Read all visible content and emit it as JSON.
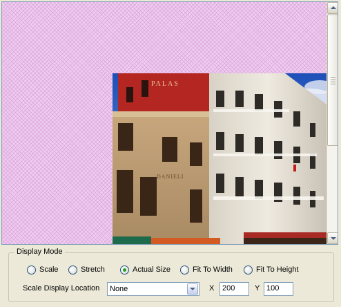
{
  "display_mode": {
    "group_label": "Display Mode",
    "options": [
      {
        "label": "Scale",
        "checked": false
      },
      {
        "label": "Stretch",
        "checked": false
      },
      {
        "label": "Actual Size",
        "checked": true
      },
      {
        "label": "Fit To Width",
        "checked": false
      },
      {
        "label": "Fit To Height",
        "checked": false
      }
    ]
  },
  "scale_location": {
    "label": "Scale Display Location",
    "selected": "None",
    "x_label": "X",
    "x_value": "200",
    "y_label": "Y",
    "y_value": "100"
  },
  "photo": {
    "facade_text": "PALAS",
    "sign_text": "DANIELI"
  },
  "colors": {
    "checker_bg": "#eecdee",
    "radio_checked": "#21a121",
    "field_border": "#7f9db9"
  }
}
